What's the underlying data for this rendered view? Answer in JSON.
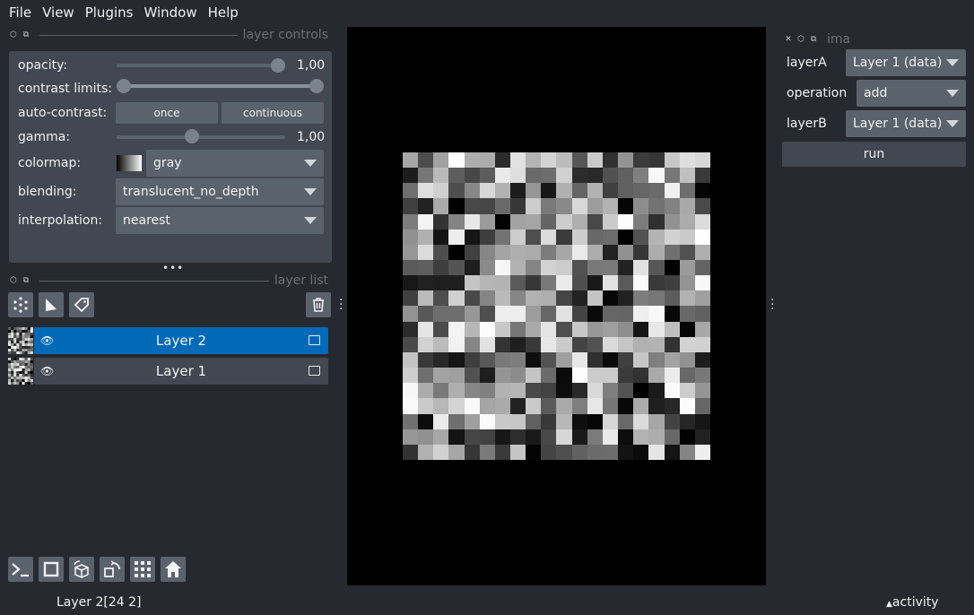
{
  "menu": [
    "File",
    "View",
    "Plugins",
    "Window",
    "Help"
  ],
  "layer_controls": {
    "title": "layer controls",
    "opacity": {
      "label": "opacity:",
      "value": "1,00",
      "level": 1.0
    },
    "contrast_limits": {
      "label": "contrast limits:",
      "low": 0.0,
      "high": 1.0
    },
    "auto_contrast": {
      "label": "auto-contrast:",
      "once": "once",
      "continuous": "continuous"
    },
    "gamma": {
      "label": "gamma:",
      "value": "1,00",
      "level": 0.45
    },
    "colormap": {
      "label": "colormap:",
      "value": "gray"
    },
    "blending": {
      "label": "blending:",
      "value": "translucent_no_depth"
    },
    "interpolation": {
      "label": "interpolation:",
      "value": "nearest"
    }
  },
  "layer_list": {
    "title": "layer list",
    "layers": [
      {
        "name": "Layer 2",
        "selected": true
      },
      {
        "name": "Layer 1",
        "selected": false
      }
    ]
  },
  "plugin_dock": {
    "title": "ima",
    "layerA_label": "layerA",
    "layerA_value": "Layer 1 (data)",
    "operation_label": "operation",
    "operation_value": "add",
    "layerB_label": "layerB",
    "layerB_value": "Layer 1 (data)",
    "run_label": "run"
  },
  "status": {
    "left": "Layer 2[24 2]",
    "activity": "activity"
  },
  "colors": {
    "selected_layer": "#0069b8",
    "panel": "#414851",
    "background": "#262930"
  },
  "icons": {
    "console": "console-icon",
    "square": "ndisplay-square-icon",
    "cube": "roll-cube-icon",
    "transpose": "transpose-icon",
    "grid": "grid-icon",
    "home": "home-icon"
  }
}
